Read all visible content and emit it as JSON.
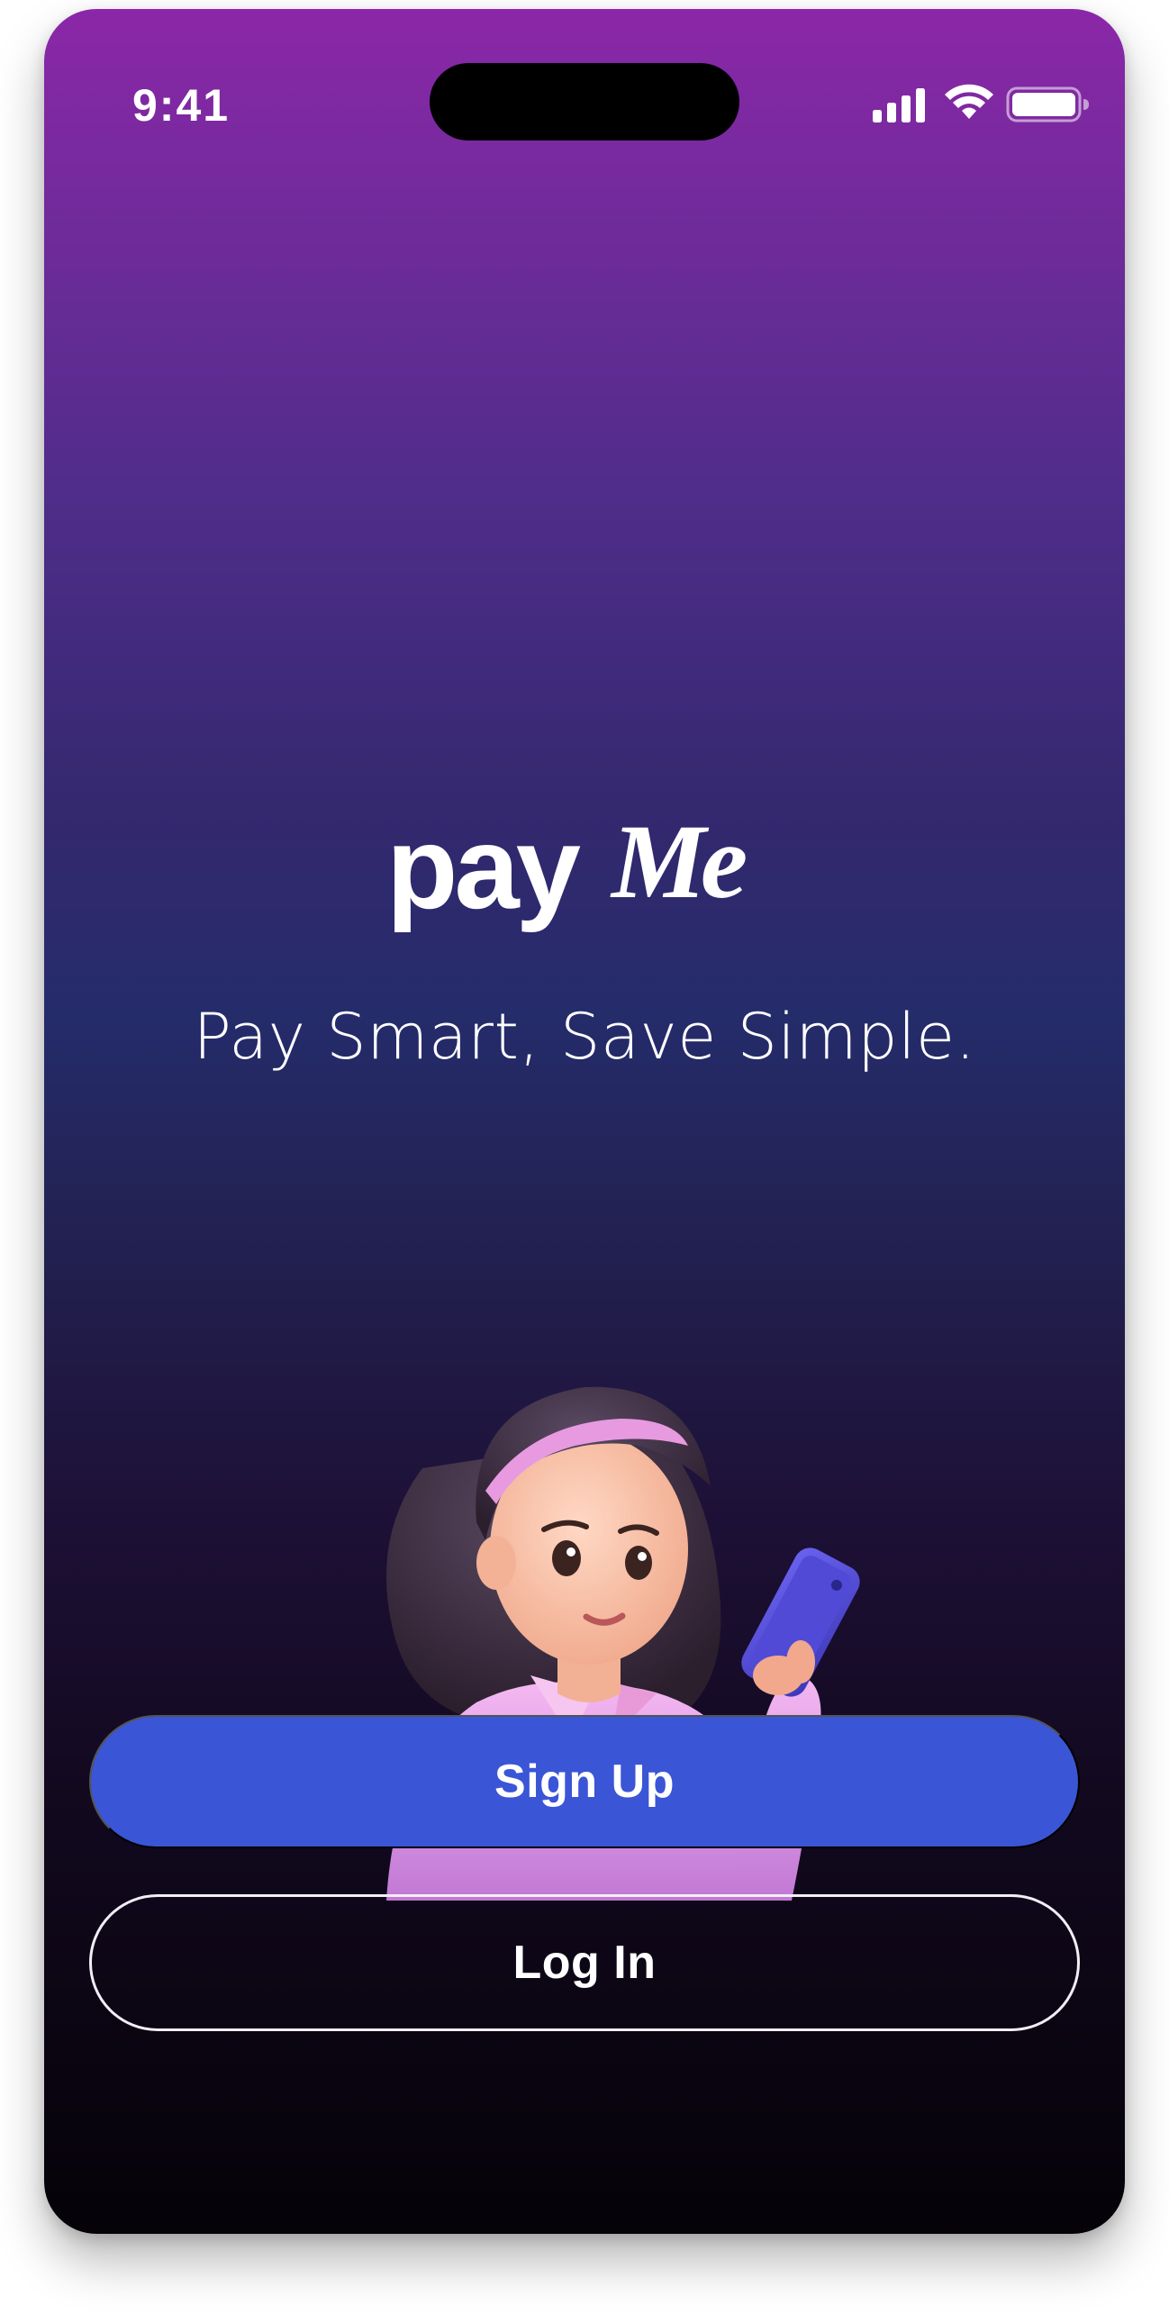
{
  "status_bar": {
    "time": "9:41",
    "icons": [
      "cellular-signal-icon",
      "wifi-icon",
      "battery-icon"
    ]
  },
  "brand": {
    "logo_text": "payMe",
    "logo_part1": "pay",
    "logo_part2": "Me"
  },
  "tagline": "Pay Smart, Save Simple.",
  "illustration": {
    "subject": "woman-holding-phone-illustration"
  },
  "actions": {
    "signup_label": "Sign Up",
    "login_label": "Log In"
  },
  "colors": {
    "gradient_top": "#8b27a8",
    "gradient_mid": "#252c6b",
    "gradient_bottom": "#050208",
    "primary_button": "#3a55d6",
    "text": "#ffffff"
  }
}
